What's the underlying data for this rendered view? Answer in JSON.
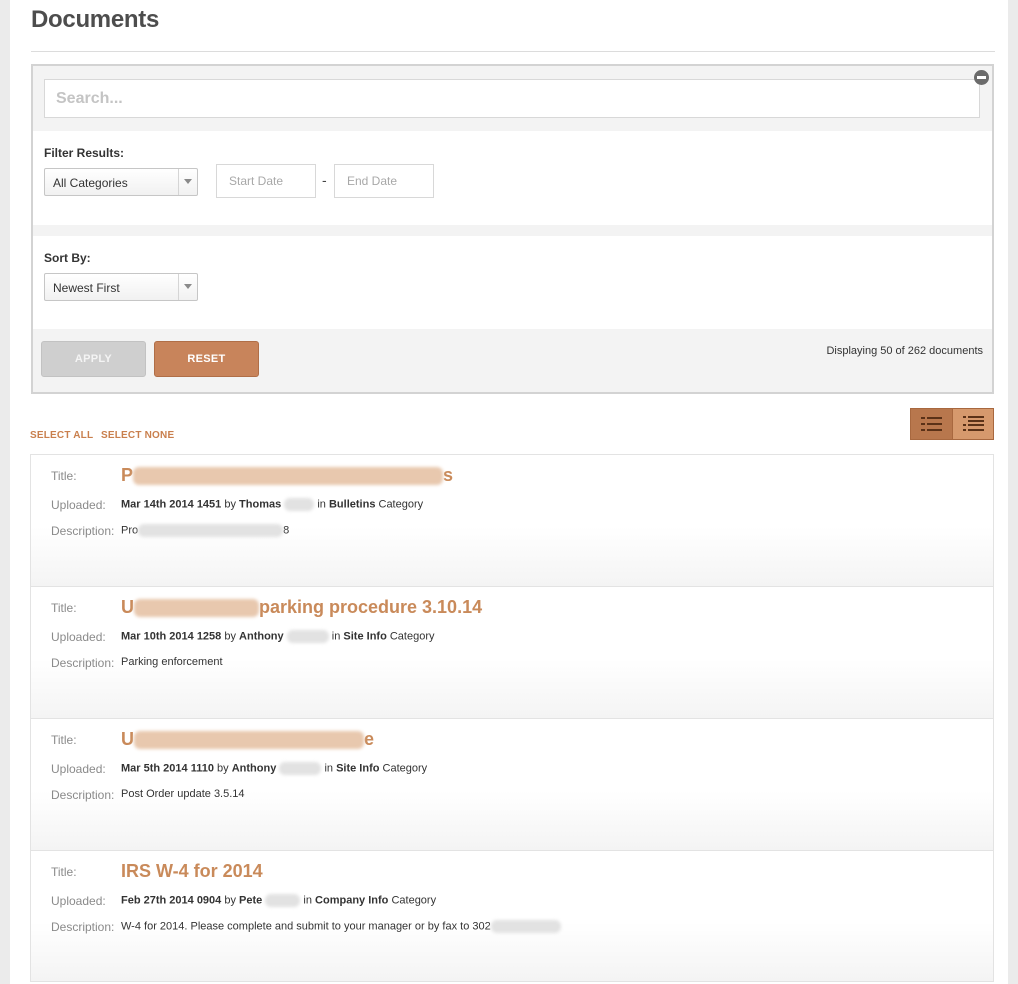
{
  "page": {
    "title": "Documents"
  },
  "search": {
    "placeholder": "Search..."
  },
  "filter": {
    "label": "Filter Results:",
    "category_value": "All Categories",
    "start_placeholder": "Start Date",
    "dash": "-",
    "end_placeholder": "End Date"
  },
  "sort": {
    "label": "Sort By:",
    "value": "Newest First"
  },
  "actions": {
    "apply_label": "APPLY",
    "reset_label": "RESET"
  },
  "results": {
    "count_text": "Displaying 50 of 262 documents"
  },
  "selection": {
    "select_all": "SELECT ALL",
    "select_none": "SELECT NONE"
  },
  "labels": {
    "title": "Title:",
    "uploaded": "Uploaded:",
    "description": "Description:"
  },
  "documents": [
    {
      "title_start": "P",
      "title_end": "s",
      "date": "Mar 14th 2014 1451",
      "by": "by",
      "author": "Thomas",
      "in": "in",
      "category": "Bulletins",
      "category_suffix": "Category",
      "desc_start": "Pro",
      "desc_end": "8"
    },
    {
      "title_start": "U",
      "title_end": "parking procedure 3.10.14",
      "date": "Mar 10th 2014 1258",
      "by": "by",
      "author": "Anthony",
      "in": "in",
      "category": "Site Info",
      "category_suffix": "Category",
      "desc_start": "Parking enforcement",
      "desc_end": ""
    },
    {
      "title_start": "U",
      "title_end": "e",
      "date": "Mar 5th 2014 1110",
      "by": "by",
      "author": "Anthony",
      "in": "in",
      "category": "Site Info",
      "category_suffix": "Category",
      "desc_start": "Post Order update 3.5.14",
      "desc_end": ""
    },
    {
      "title_start": "IRS W-4 for 2014",
      "title_end": "",
      "date": "Feb 27th 2014 0904",
      "by": "by",
      "author": "Pete",
      "in": "in",
      "category": "Company Info",
      "category_suffix": "Category",
      "desc_start": "W-4 for 2014. Please complete and submit to your manager or by fax to 302",
      "desc_end": ""
    }
  ],
  "colors": {
    "accent": "#c98a5a",
    "reset_button": "#c8845b",
    "apply_button": "#cfcfcf"
  },
  "icons": {
    "collapse": "minus-circle-icon",
    "view_compact": "list-icon",
    "view_detailed": "bullet-list-icon"
  }
}
